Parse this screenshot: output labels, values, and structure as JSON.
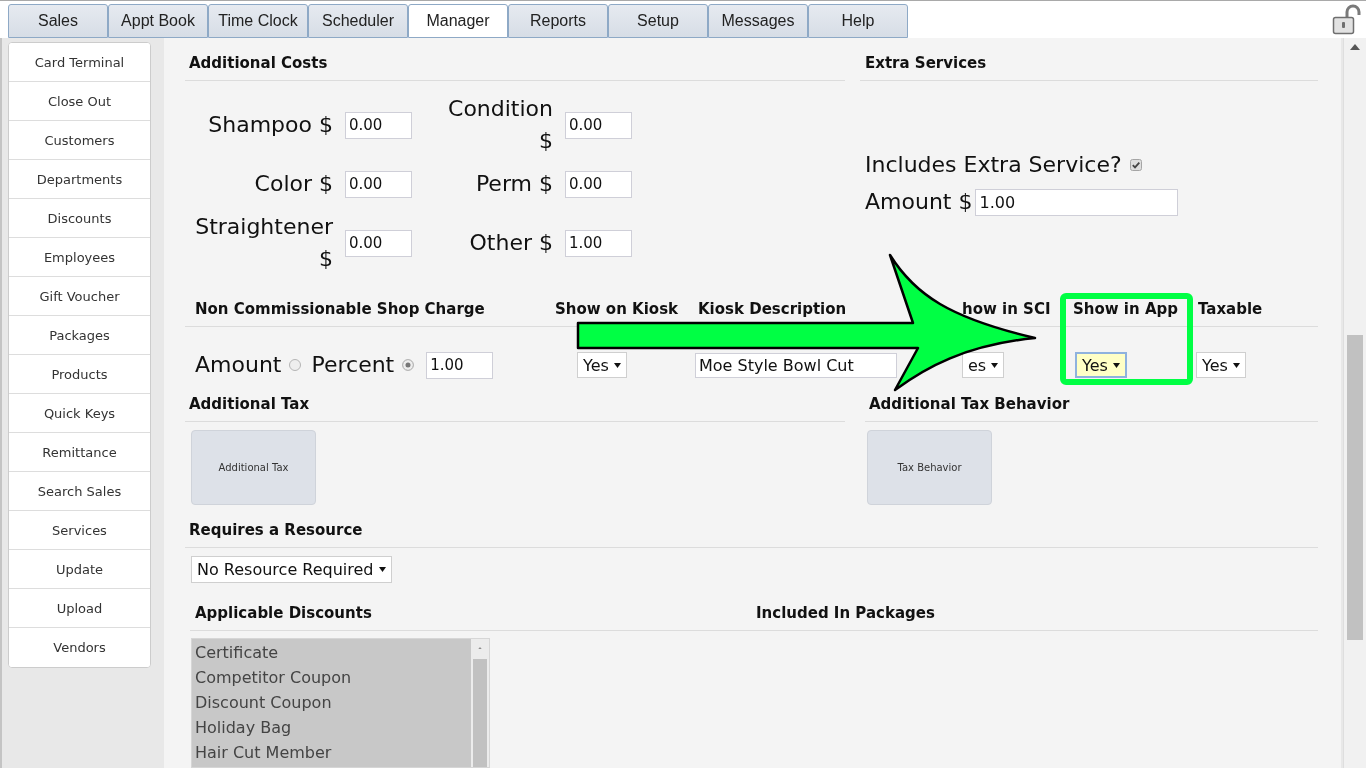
{
  "tabs": [
    {
      "label": "Sales",
      "selected": false
    },
    {
      "label": "Appt Book",
      "selected": false
    },
    {
      "label": "Time Clock",
      "selected": false
    },
    {
      "label": "Scheduler",
      "selected": false
    },
    {
      "label": "Manager",
      "selected": true
    },
    {
      "label": "Reports",
      "selected": false
    },
    {
      "label": "Setup",
      "selected": false
    },
    {
      "label": "Messages",
      "selected": false
    },
    {
      "label": "Help",
      "selected": false
    }
  ],
  "sidebar": {
    "items": [
      "Card Terminal",
      "Close Out",
      "Customers",
      "Departments",
      "Discounts",
      "Employees",
      "Gift Voucher",
      "Packages",
      "Products",
      "Quick Keys",
      "Remittance",
      "Search Sales",
      "Services",
      "Update",
      "Upload",
      "Vendors"
    ]
  },
  "additional_costs": {
    "title": "Additional Costs",
    "fields": [
      {
        "label": "Shampoo $",
        "value": "0.00"
      },
      {
        "label": "Color $",
        "value": "0.00"
      },
      {
        "label": "Straightener $",
        "value": "0.00"
      },
      {
        "label": "Condition $",
        "value": "0.00"
      },
      {
        "label": "Perm $",
        "value": "0.00"
      },
      {
        "label": "Other $",
        "value": "1.00"
      }
    ]
  },
  "extra_services": {
    "title": "Extra Services",
    "includes": {
      "label": "Includes Extra Service?",
      "checked": true
    },
    "amount": {
      "label": "Amount $",
      "value": "1.00"
    }
  },
  "shop_charge": {
    "columns": [
      "Non Commissionable Shop Charge",
      "Show on Kiosk",
      "Kiosk Description",
      "how in SCI",
      "Show in App",
      "Taxable"
    ],
    "charge_types": [
      {
        "label": "Amount",
        "selected": false
      },
      {
        "label": "Percent",
        "selected": true
      }
    ],
    "charge_value": "1.00",
    "show_on_kiosk": {
      "value": "Yes",
      "focused": false
    },
    "kiosk_description": "Moe Style Bowl Cut",
    "show_in_sci": {
      "value": "es",
      "focused": false
    },
    "show_in_app": {
      "value": "Yes",
      "focused": true
    },
    "taxable": {
      "value": "Yes",
      "focused": false
    }
  },
  "additional_tax": {
    "title": "Additional Tax",
    "button": "Additional Tax",
    "behavior_title": "Additional Tax Behavior",
    "behavior_button": "Tax Behavior"
  },
  "resource": {
    "title": "Requires a Resource",
    "value": "No Resource Required"
  },
  "discounts": {
    "title": "Applicable Discounts",
    "disabled": true,
    "items": [
      "Certificate",
      "Competitor Coupon",
      "Discount Coupon",
      "Holiday Bag",
      "Hair Cut Member"
    ]
  },
  "packages": {
    "title": "Included In Packages"
  }
}
